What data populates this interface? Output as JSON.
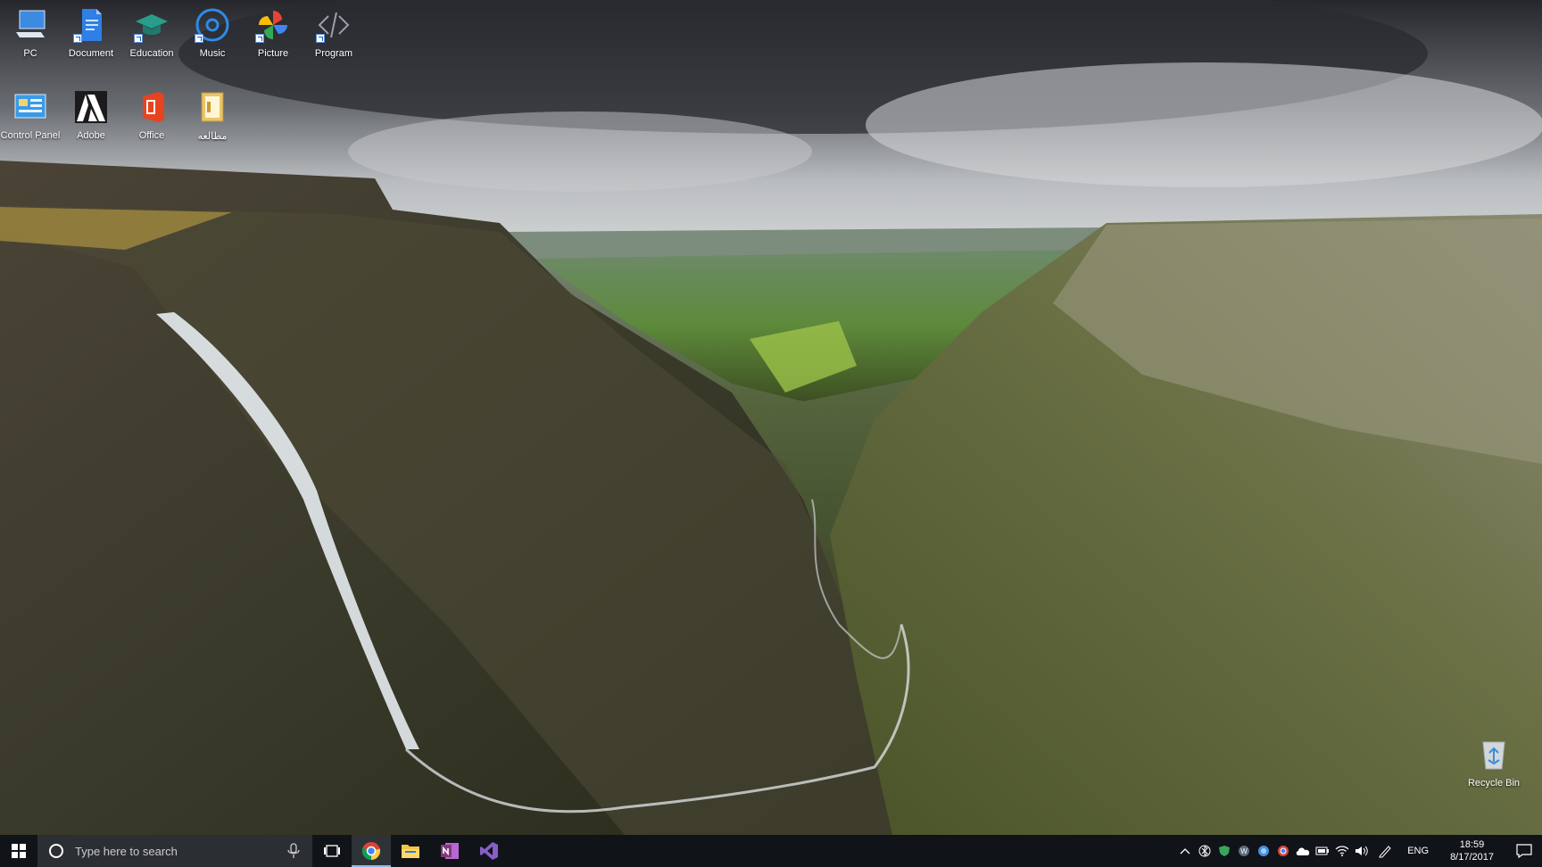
{
  "desktop": {
    "icons_row1": [
      {
        "name": "pc-icon",
        "label": "PC"
      },
      {
        "name": "document-icon",
        "label": "Document"
      },
      {
        "name": "education-icon",
        "label": "Education"
      },
      {
        "name": "music-icon",
        "label": "Music"
      },
      {
        "name": "picture-icon",
        "label": "Picture"
      },
      {
        "name": "program-icon",
        "label": "Program"
      }
    ],
    "icons_row2": [
      {
        "name": "control-panel-icon",
        "label": "Control Panel"
      },
      {
        "name": "adobe-icon",
        "label": "Adobe"
      },
      {
        "name": "office-icon",
        "label": "Office"
      },
      {
        "name": "folder-icon",
        "label": "مطالعه"
      }
    ],
    "recycle_bin": {
      "label": "Recycle Bin"
    }
  },
  "taskbar": {
    "search_placeholder": "Type here to search",
    "pinned": [
      "chrome-icon",
      "file-explorer-icon",
      "onenote-icon",
      "visual-studio-icon"
    ],
    "tray": {
      "language": "ENG",
      "time": "18:59",
      "date": "8/17/2017"
    }
  },
  "colors": {
    "taskbar_bg": "#101317",
    "search_bg": "#2b2e33",
    "active_indicator": "#8fb8e6"
  }
}
